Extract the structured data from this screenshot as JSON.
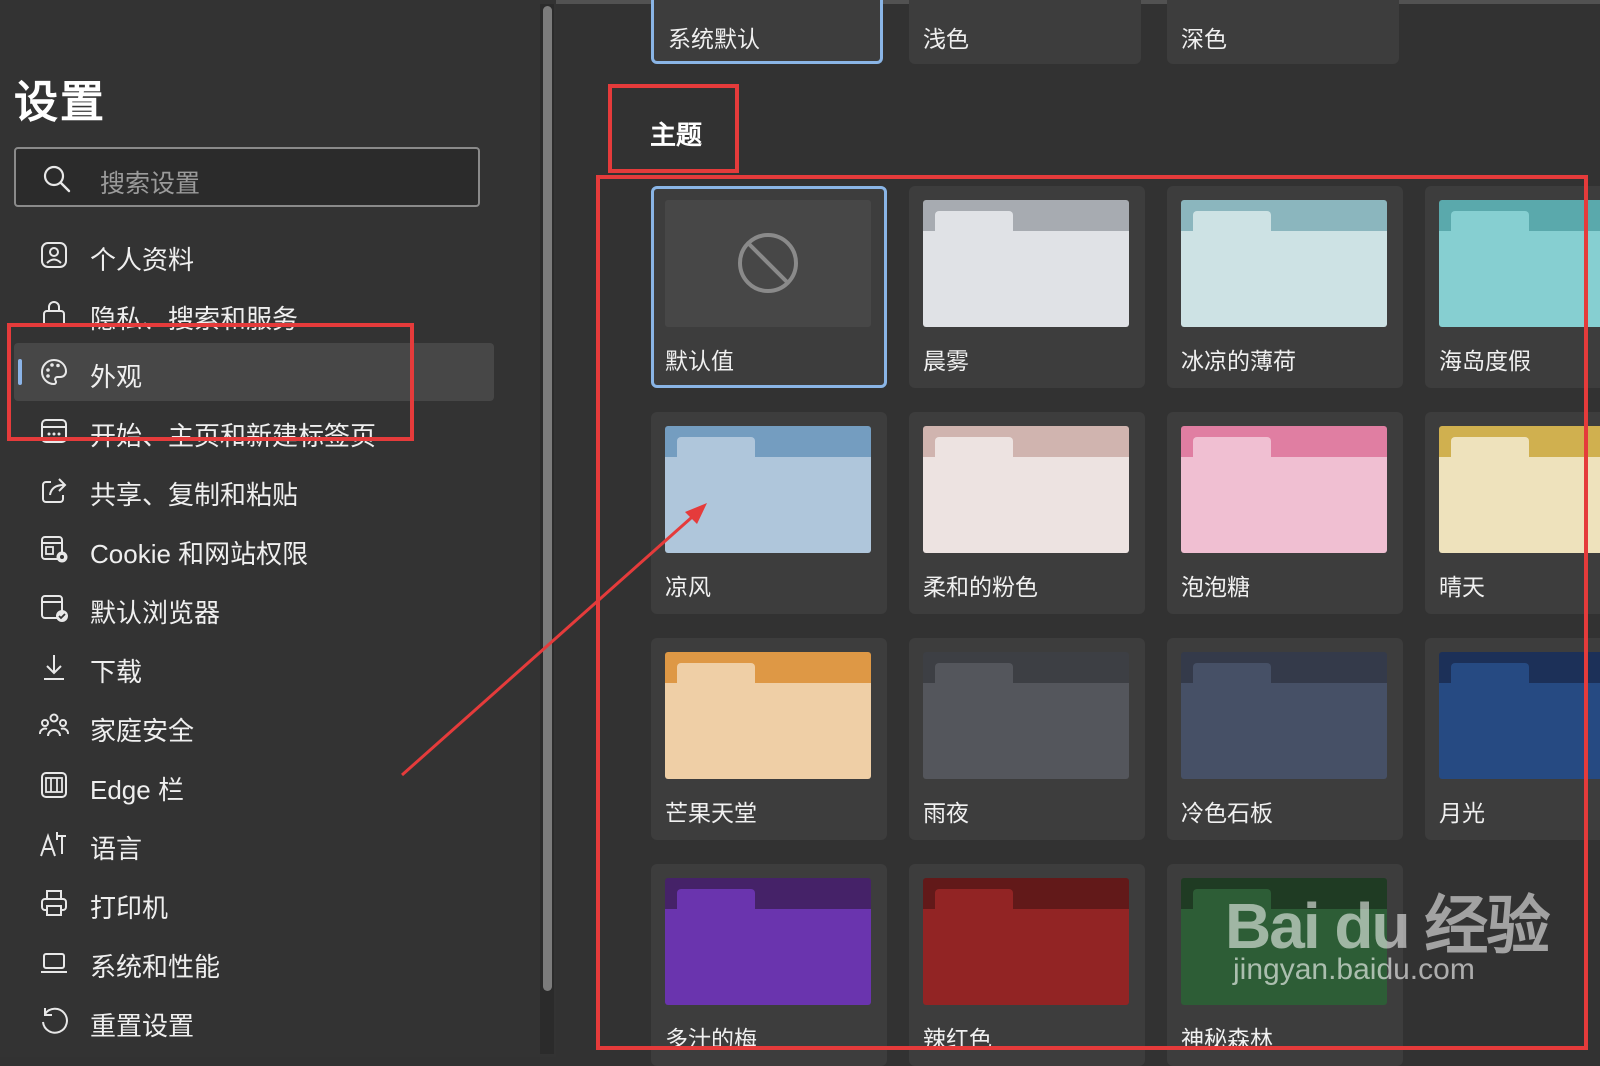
{
  "sidebar": {
    "title": "设置",
    "search_placeholder": "搜索设置",
    "items": [
      {
        "label": "个人资料",
        "icon": "profile-icon"
      },
      {
        "label": "隐私、搜索和服务",
        "icon": "lock-icon"
      },
      {
        "label": "外观",
        "icon": "palette-icon",
        "active": true
      },
      {
        "label": "开始、主页和新建标签页",
        "icon": "home-tabs-icon"
      },
      {
        "label": "共享、复制和粘贴",
        "icon": "share-icon"
      },
      {
        "label": "Cookie 和网站权限",
        "icon": "site-permissions-icon"
      },
      {
        "label": "默认浏览器",
        "icon": "default-browser-icon"
      },
      {
        "label": "下载",
        "icon": "download-icon"
      },
      {
        "label": "家庭安全",
        "icon": "family-icon"
      },
      {
        "label": "Edge 栏",
        "icon": "edge-bar-icon"
      },
      {
        "label": "语言",
        "icon": "language-icon"
      },
      {
        "label": "打印机",
        "icon": "printer-icon"
      },
      {
        "label": "系统和性能",
        "icon": "laptop-icon"
      },
      {
        "label": "重置设置",
        "icon": "reset-icon"
      }
    ]
  },
  "appearance_modes": [
    {
      "label": "系统默认",
      "selected": true
    },
    {
      "label": "浅色",
      "selected": false
    },
    {
      "label": "深色",
      "selected": false
    }
  ],
  "themes_section": {
    "title": "主题",
    "themes": [
      {
        "label": "默认值",
        "selected": true,
        "colors": {
          "strip": "#474747",
          "body": "#474747",
          "tab": "#474747"
        }
      },
      {
        "label": "晨雾",
        "colors": {
          "strip": "#a7abb1",
          "body": "#e0e2e6",
          "tab": "#e0e2e6"
        }
      },
      {
        "label": "冰凉的薄荷",
        "colors": {
          "strip": "#8bb6be",
          "body": "#cde2e4",
          "tab": "#cde2e4"
        }
      },
      {
        "label": "海岛度假",
        "colors": {
          "strip": "#5aa9ac",
          "body": "#86cfd1",
          "tab": "#86cfd1"
        }
      },
      {
        "label": "凉风",
        "colors": {
          "strip": "#749dc0",
          "body": "#afc6db",
          "tab": "#afc6db"
        }
      },
      {
        "label": "柔和的粉色",
        "colors": {
          "strip": "#d0b4af",
          "body": "#ede3e1",
          "tab": "#ede3e1"
        }
      },
      {
        "label": "泡泡糖",
        "colors": {
          "strip": "#e07ea2",
          "body": "#f0bfd2",
          "tab": "#f0bfd2"
        }
      },
      {
        "label": "晴天",
        "colors": {
          "strip": "#d0b04f",
          "body": "#eee2bc",
          "tab": "#eee2bc"
        }
      },
      {
        "label": "芒果天堂",
        "colors": {
          "strip": "#de9845",
          "body": "#efcfa6",
          "tab": "#efcfa6"
        }
      },
      {
        "label": "雨夜",
        "colors": {
          "strip": "#3d3f44",
          "body": "#54565c",
          "tab": "#54565c"
        }
      },
      {
        "label": "冷色石板",
        "colors": {
          "strip": "#343a4a",
          "body": "#465066",
          "tab": "#465066"
        }
      },
      {
        "label": "月光",
        "colors": {
          "strip": "#1c3058",
          "body": "#264a82",
          "tab": "#264a82"
        }
      },
      {
        "label": "多汁的梅",
        "colors": {
          "strip": "#452268",
          "body": "#6a34ae",
          "tab": "#6a34ae"
        }
      },
      {
        "label": "辣红色",
        "colors": {
          "strip": "#621919",
          "body": "#922424",
          "tab": "#922424"
        }
      },
      {
        "label": "神秘森林",
        "colors": {
          "strip": "#1f3b23",
          "body": "#2d5d36",
          "tab": "#2d5d36"
        }
      }
    ]
  },
  "annotation_color": "#e53b3b",
  "watermark": {
    "logo": "Bai du 经验",
    "url": "jingyan.baidu.com"
  }
}
